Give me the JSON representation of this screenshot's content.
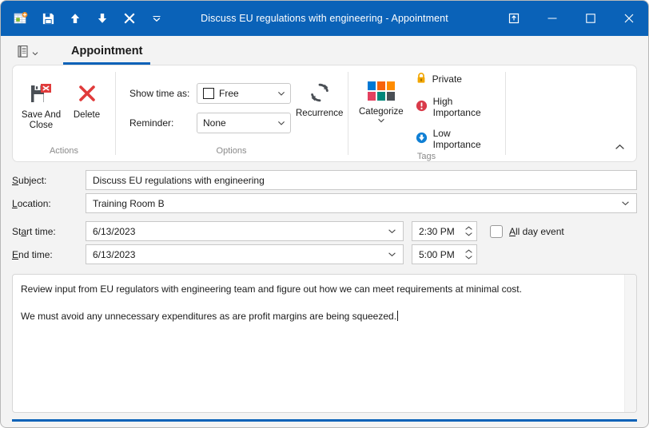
{
  "window": {
    "title": "Discuss EU regulations with engineering - Appointment",
    "accent_color": "#0a62b8",
    "titlebar_color": "#0a62b8"
  },
  "quick_access": {
    "items": [
      {
        "name": "new-appointment-icon",
        "tooltip": "New Appointment"
      },
      {
        "name": "save-icon",
        "tooltip": "Save"
      },
      {
        "name": "previous-item-icon",
        "tooltip": "Previous Item"
      },
      {
        "name": "next-item-icon",
        "tooltip": "Next Item"
      },
      {
        "name": "close-icon",
        "tooltip": "Close"
      },
      {
        "name": "customize-quick-access-toolbar-icon",
        "tooltip": "Customize Quick Access Toolbar"
      }
    ]
  },
  "window_controls": {
    "restore_down_label": "Restore Down",
    "minimize_label": "Minimize",
    "maximize_label": "Maximize",
    "close_label": "Close"
  },
  "tabs": {
    "file_menu_label": "File",
    "items": [
      {
        "label": "Appointment",
        "active": true
      }
    ]
  },
  "ribbon": {
    "groups": [
      {
        "label": "Actions",
        "buttons": [
          {
            "label_line1": "Save And",
            "label_line2": "Close",
            "icon": "save-and-close-icon"
          },
          {
            "label_line1": "Delete",
            "label_line2": "",
            "icon": "delete-icon"
          }
        ]
      },
      {
        "label": "Options",
        "show_time_as_label": "Show time as:",
        "show_time_as_value": "Free",
        "reminder_label": "Reminder:",
        "reminder_value": "None",
        "recurrence_label": "Recurrence"
      },
      {
        "label": "Tags",
        "categorize_label": "Categorize",
        "categorize_colors": [
          "#0078d4",
          "#f7630c",
          "#ff8c00",
          "#e3405f",
          "#00877a",
          "#4a4f55"
        ],
        "tags": [
          {
            "label": "Private",
            "icon": "lock-icon",
            "color": "#f2a600"
          },
          {
            "label": "High Importance",
            "icon": "exclamation-icon",
            "color": "#d93b4a"
          },
          {
            "label": "Low Importance",
            "icon": "down-arrow-icon",
            "color": "#0f7fd4"
          }
        ]
      }
    ],
    "collapse_label": "Collapse the Ribbon"
  },
  "form": {
    "subject_label": "Subject:",
    "subject_value": "Discuss EU regulations with engineering",
    "location_label": "Location:",
    "location_value": "Training Room B",
    "start_time_label": "Start time:",
    "start_date_value": "6/13/2023",
    "start_time_value": "2:30 PM",
    "end_time_label": "End time:",
    "end_date_value": "6/13/2023",
    "end_time_value": "5:00 PM",
    "all_day_event_label": "All day event",
    "all_day_event_checked": false
  },
  "notes": {
    "paragraph_1": "Review input from EU regulators with engineering team and figure out how we can meet requirements at minimal cost.",
    "paragraph_2": "We must avoid any unnecessary expenditures as are profit margins are being squeezed."
  }
}
